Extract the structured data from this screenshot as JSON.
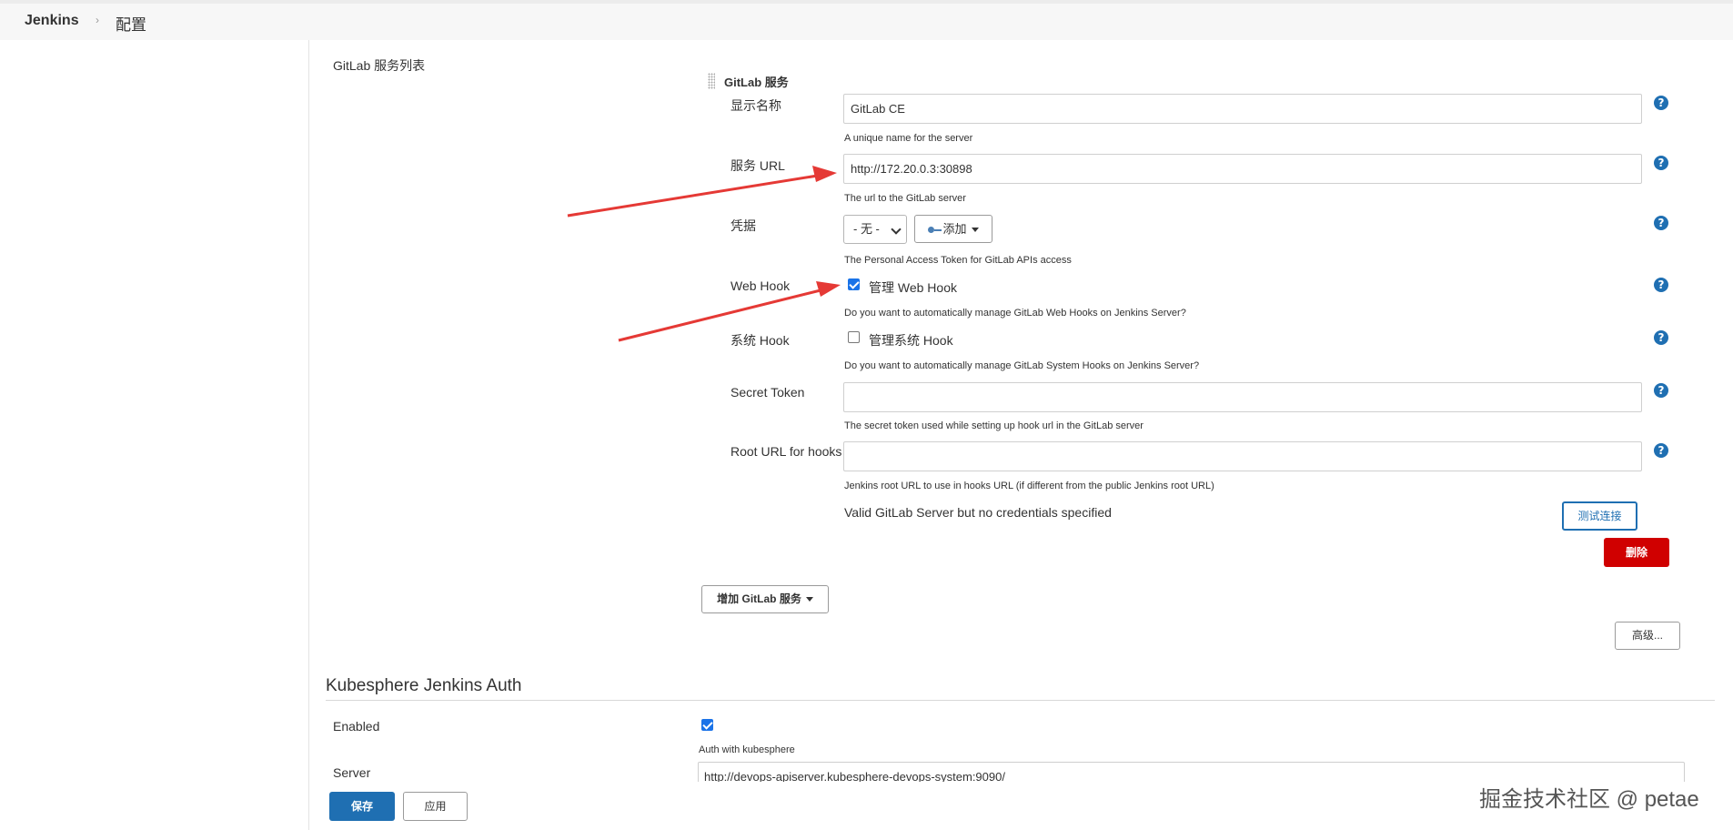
{
  "header": {
    "brand": "Jenkins",
    "separator": "›",
    "page": "配置"
  },
  "gitlab": {
    "section_label": "GitLab 服务列表",
    "service_title": "GitLab 服务",
    "display_name_label": "显示名称",
    "display_name_value": "GitLab CE",
    "display_name_desc": "A unique name for the server",
    "url_label": "服务 URL",
    "url_value": "http://172.20.0.3:30898",
    "url_desc": "The url to the GitLab server",
    "credentials_label": "凭据",
    "credentials_selected": "- 无 -",
    "add_label": "添加",
    "credentials_desc": "The Personal Access Token for GitLab APIs access",
    "webhook_label": "Web Hook",
    "webhook_checkbox_label": "管理 Web Hook",
    "webhook_checked": true,
    "webhook_desc": "Do you want to automatically manage GitLab Web Hooks on Jenkins Server?",
    "systemhook_label": "系统 Hook",
    "systemhook_checkbox_label": "管理系统 Hook",
    "systemhook_checked": false,
    "systemhook_desc": "Do you want to automatically manage GitLab System Hooks on Jenkins Server?",
    "secret_label": "Secret Token",
    "secret_value": "",
    "secret_desc": "The secret token used while setting up hook url in the GitLab server",
    "rooturl_label": "Root URL for hooks",
    "rooturl_value": "",
    "rooturl_desc": "Jenkins root URL to use in hooks URL (if different from the public Jenkins root URL)",
    "status_text": "Valid GitLab Server but no credentials specified",
    "test_button": "测试连接",
    "delete_button": "删除",
    "add_service_button": "增加 GitLab 服务",
    "advanced_button": "高级..."
  },
  "kubesphere": {
    "section_title": "Kubesphere Jenkins Auth",
    "enabled_label": "Enabled",
    "enabled_checked": true,
    "enabled_desc": "Auth with kubesphere",
    "server_label": "Server",
    "server_value": "http://devops-apiserver.kubesphere-devops-system:9090/"
  },
  "footer": {
    "save_button": "保存",
    "apply_button": "应用"
  },
  "watermark": "掘金技术社区 @ petae",
  "help_glyph": "?",
  "colors": {
    "accent": "#1f6fb2",
    "delete": "#d00000",
    "arrow": "#e53935",
    "checkbox": "#1a73e8"
  }
}
